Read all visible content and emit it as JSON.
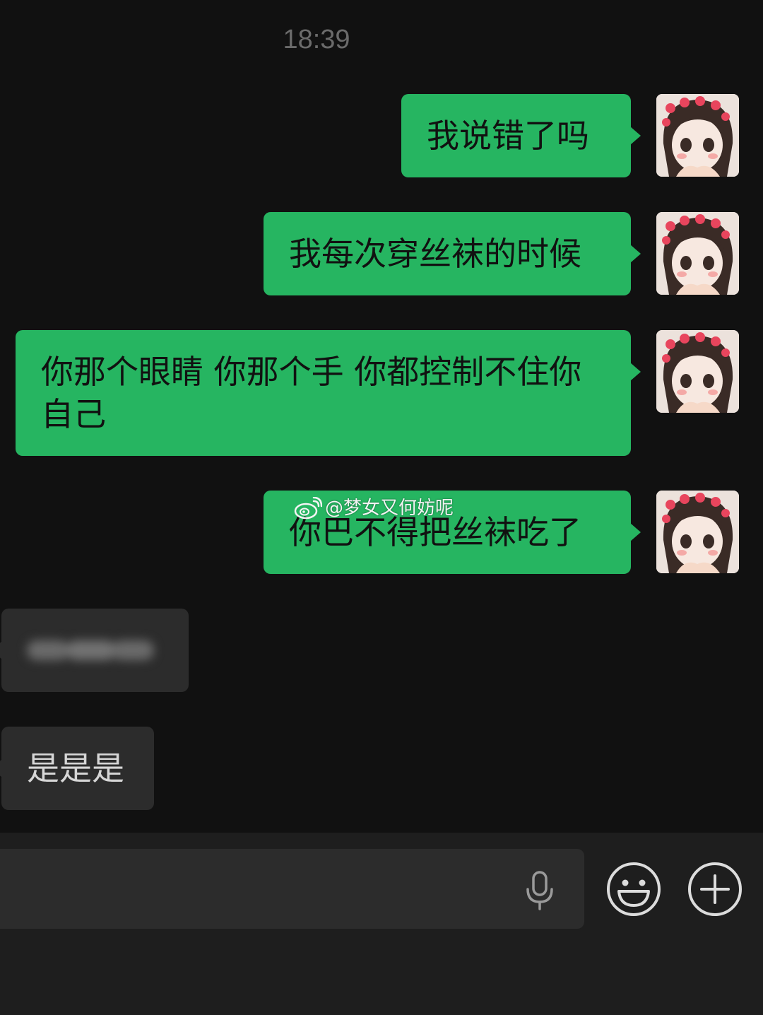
{
  "chat": {
    "timestamp": "18:39",
    "messages": [
      {
        "direction": "out",
        "text": "我说错了吗"
      },
      {
        "direction": "out",
        "text": "我每次穿丝袜的时候"
      },
      {
        "direction": "out",
        "text": "你那个眼睛 你那个手 你都控制不住你自己"
      },
      {
        "direction": "out",
        "text": "你巴不得把丝袜吃了"
      },
      {
        "direction": "in",
        "text": "",
        "blurred": true
      },
      {
        "direction": "in",
        "text": "是是是"
      }
    ],
    "watermark": "@梦女又何妨呢"
  },
  "input_bar": {
    "icons": [
      "microphone-icon",
      "emoji-icon",
      "plus-icon"
    ]
  },
  "colors": {
    "background": "#111111",
    "outgoing_bubble": "#26b561",
    "incoming_bubble": "#2c2c2c",
    "bottom_bar": "#1e1e1e"
  }
}
